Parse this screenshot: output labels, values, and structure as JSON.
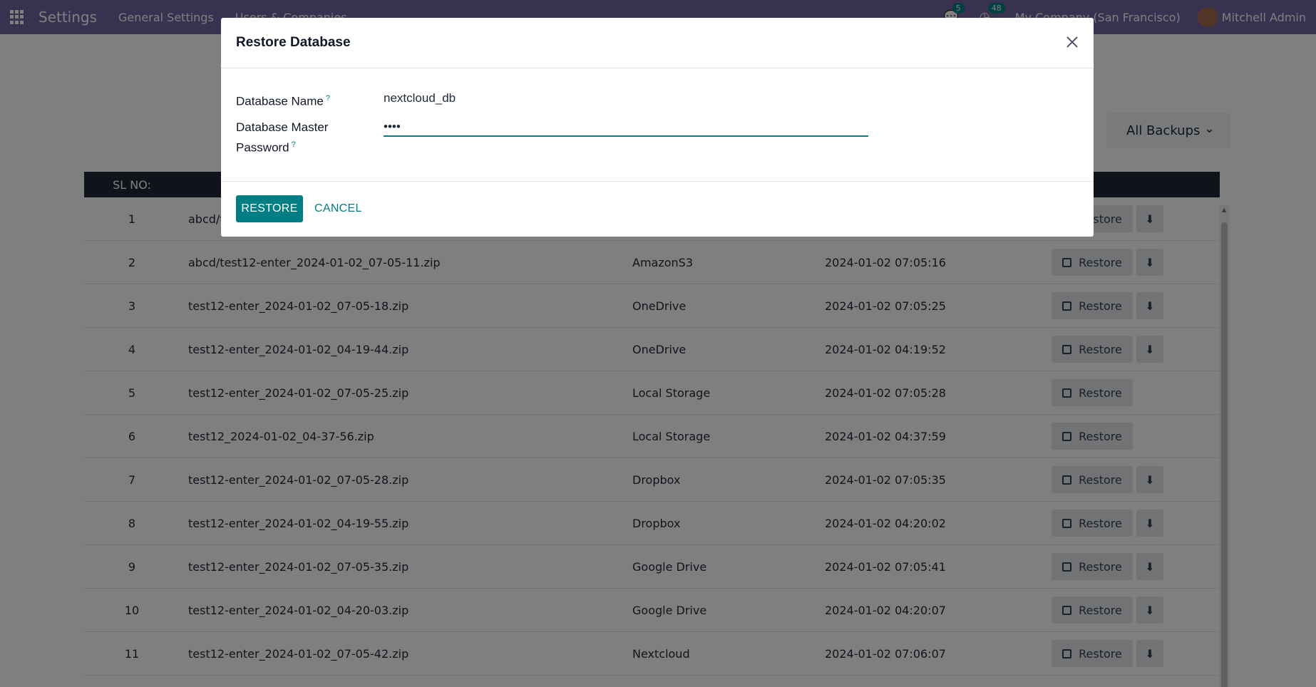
{
  "navbar": {
    "brand": "Settings",
    "menu": [
      "General Settings",
      "Users & Companies"
    ],
    "messages_badge": "5",
    "activities_badge": "48",
    "company": "My Company (San Francisco)",
    "user": "Mitchell Admin"
  },
  "filter": {
    "label": "All Backups"
  },
  "table": {
    "header_sl": "SL NO:",
    "restore_label": "Restore",
    "rows": [
      {
        "sl": "1",
        "file": "abcd/t",
        "storage": "",
        "date": "",
        "download": true
      },
      {
        "sl": "2",
        "file": "abcd/test12-enter_2024-01-02_07-05-11.zip",
        "storage": "AmazonS3",
        "date": "2024-01-02 07:05:16",
        "download": true
      },
      {
        "sl": "3",
        "file": "test12-enter_2024-01-02_07-05-18.zip",
        "storage": "OneDrive",
        "date": "2024-01-02 07:05:25",
        "download": true
      },
      {
        "sl": "4",
        "file": "test12-enter_2024-01-02_04-19-44.zip",
        "storage": "OneDrive",
        "date": "2024-01-02 04:19:52",
        "download": true
      },
      {
        "sl": "5",
        "file": "test12-enter_2024-01-02_07-05-25.zip",
        "storage": "Local Storage",
        "date": "2024-01-02 07:05:28",
        "download": false
      },
      {
        "sl": "6",
        "file": "test12_2024-01-02_04-37-56.zip",
        "storage": "Local Storage",
        "date": "2024-01-02 04:37:59",
        "download": false
      },
      {
        "sl": "7",
        "file": "test12-enter_2024-01-02_07-05-28.zip",
        "storage": "Dropbox",
        "date": "2024-01-02 07:05:35",
        "download": true
      },
      {
        "sl": "8",
        "file": "test12-enter_2024-01-02_04-19-55.zip",
        "storage": "Dropbox",
        "date": "2024-01-02 04:20:02",
        "download": true
      },
      {
        "sl": "9",
        "file": "test12-enter_2024-01-02_07-05-35.zip",
        "storage": "Google Drive",
        "date": "2024-01-02 07:05:41",
        "download": true
      },
      {
        "sl": "10",
        "file": "test12-enter_2024-01-02_04-20-03.zip",
        "storage": "Google Drive",
        "date": "2024-01-02 04:20:07",
        "download": true
      },
      {
        "sl": "11",
        "file": "test12-enter_2024-01-02_07-05-42.zip",
        "storage": "Nextcloud",
        "date": "2024-01-02 07:06:07",
        "download": true
      }
    ]
  },
  "modal": {
    "title": "Restore Database",
    "db_name_label": "Database Name",
    "db_name_value": "nextcloud_db",
    "pw_label_line1": "Database Master",
    "pw_label_line2": "Password",
    "help_mark": "?",
    "pw_value": "••••",
    "restore_button": "RESTORE",
    "cancel_button": "CANCEL"
  }
}
